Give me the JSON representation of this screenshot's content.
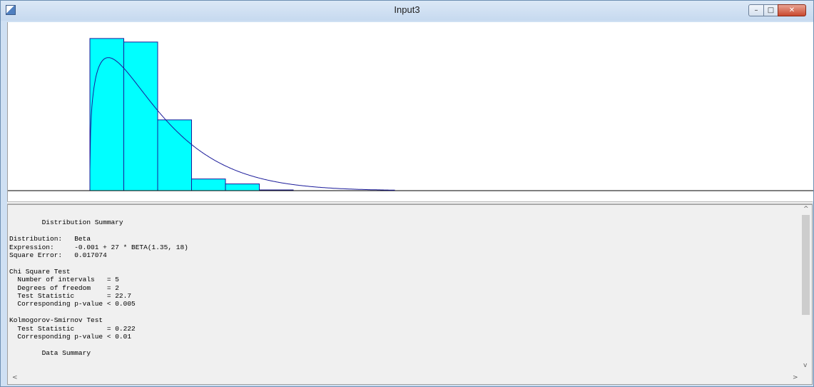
{
  "window": {
    "title": "Input3",
    "controls": {
      "minimize": "–",
      "maximize": "□",
      "close": "✕"
    },
    "icon": "app-document-icon"
  },
  "chart_data": {
    "type": "bar",
    "description": "histogram with fitted beta density curve",
    "title": "",
    "xlabel": "",
    "ylabel": "",
    "bin_edges": [
      0,
      1,
      2,
      3,
      4,
      5,
      6,
      7,
      8,
      9,
      10,
      11,
      12,
      13,
      14,
      15,
      16,
      17,
      18,
      19,
      20,
      21,
      22,
      23,
      24,
      25,
      26,
      27
    ],
    "values": [
      0.43,
      0.42,
      0.2,
      0.033,
      0.019,
      0.002,
      0,
      0,
      0,
      0,
      0,
      0,
      0,
      0,
      0,
      0,
      0,
      0,
      0,
      0,
      0,
      0,
      0,
      0,
      0,
      0,
      0.002
    ],
    "fit_curve": {
      "distribution": "Beta",
      "offset": -0.001,
      "scale": 27,
      "alpha": 1.35,
      "beta": 18
    },
    "ylim": [
      0,
      0.45
    ],
    "colors": {
      "bars": "#00ffff",
      "bar_edges": "#1a1a9a",
      "curve": "#1a1a9a",
      "axis": "#000000"
    },
    "grid": false,
    "legend": "none"
  },
  "summary": {
    "lines": [
      "",
      "        Distribution Summary",
      "",
      "Distribution:   Beta",
      "Expression:     -0.001 + 27 * BETA(1.35, 18)",
      "Square Error:   0.017074",
      "",
      "Chi Square Test",
      "  Number of intervals   = 5",
      "  Degrees of freedom    = 2",
      "  Test Statistic        = 22.7",
      "  Corresponding p-value < 0.005",
      "",
      "Kolmogorov-Smirnov Test",
      "  Test Statistic        = 0.222",
      "  Corresponding p-value < 0.01",
      "",
      "        Data Summary"
    ]
  },
  "scrollbar": {
    "up": "^",
    "down": "v",
    "left": "<",
    "right": ">"
  }
}
